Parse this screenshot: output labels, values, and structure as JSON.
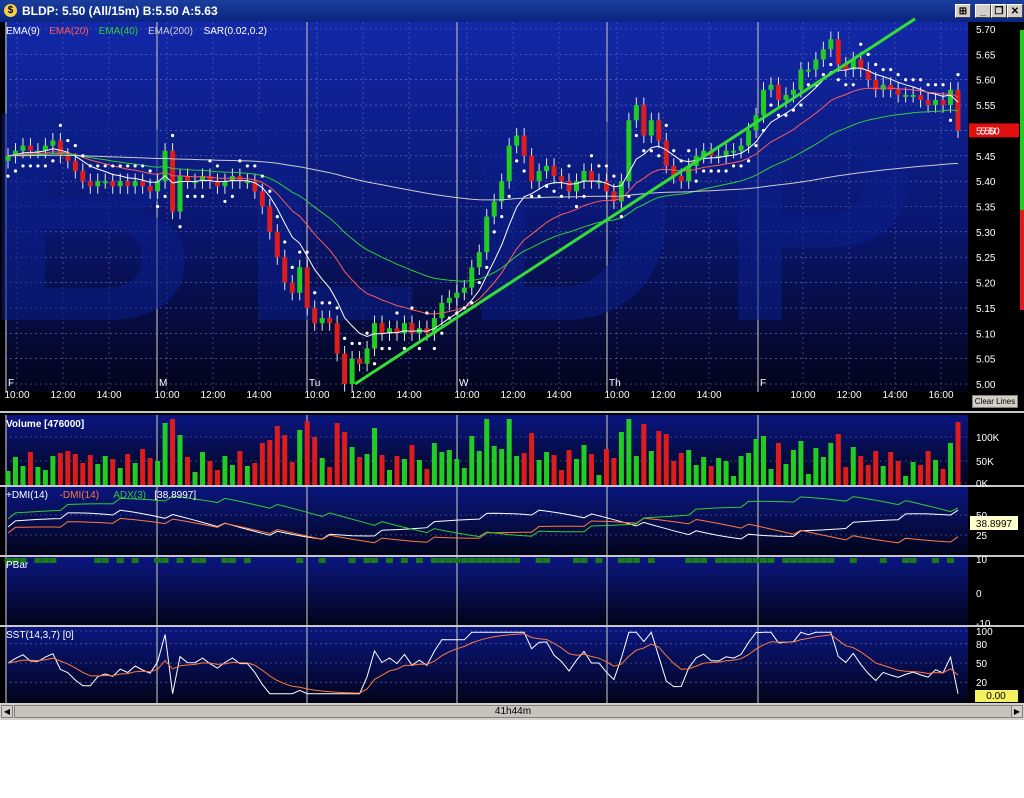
{
  "window": {
    "title": "BLDP: 5.50 (All/15m)  B:5.50  A:5.63",
    "watermark": "BLDP",
    "buttons": [
      "minimize",
      "restore",
      "maximize",
      "close"
    ]
  },
  "colors": {
    "background_top": "#1428a0",
    "background_bottom": "#000010",
    "trendline": "#33dd33",
    "up_candle": "#22cc22",
    "down_candle": "#dd1d1d",
    "sar_dots": "#ffffff",
    "last_price_badge": "#e01010",
    "last_value_badge": "#f5f060"
  },
  "price_panel": {
    "legend": [
      {
        "label": "EMA(9)",
        "color": "#ffffff"
      },
      {
        "label": "EMA(20)",
        "color": "#ff5a5a"
      },
      {
        "label": "EMA(40)",
        "color": "#33cc33"
      },
      {
        "label": "EMA(200)",
        "color": "#cccccc"
      },
      {
        "label": "SAR(0.02,0.2)",
        "color": "#ffffff"
      }
    ],
    "y_ticks": [
      "5.70",
      "5.65",
      "5.60",
      "5.55",
      "5.50",
      "5.45",
      "5.40",
      "5.35",
      "5.30",
      "5.25",
      "5.20",
      "5.15",
      "5.10",
      "5.05",
      "5.00"
    ],
    "last_price": "5.50",
    "day_labels": [
      "F",
      "M",
      "Tu",
      "W",
      "Th",
      "F"
    ],
    "time_labels": [
      "10:00",
      "12:00",
      "14:00",
      "10:00",
      "12:00",
      "14:00",
      "10:00",
      "12:00",
      "14:00",
      "10:00",
      "12:00",
      "14:00",
      "10:00",
      "12:00",
      "14:00",
      "10:00",
      "12:00",
      "14:00",
      "16:00"
    ],
    "clear_lines": "Clear Lines"
  },
  "volume_panel": {
    "title": "Volume",
    "value": "[476000]",
    "y_ticks": [
      "100K",
      "50K",
      "0K"
    ]
  },
  "dmi_panel": {
    "legend": [
      {
        "label": "+DMI(14)",
        "color": "#ffffff"
      },
      {
        "label": "-DMI(14)",
        "color": "#ff7a3a"
      },
      {
        "label": "ADX(3)",
        "color": "#33cc33"
      }
    ],
    "value": "[38.8997]",
    "badge": "38.8997",
    "y_ticks": [
      "50",
      "25"
    ]
  },
  "pbar_panel": {
    "title": "PBar",
    "y_ticks": [
      "10",
      "0",
      "-10"
    ]
  },
  "sst_panel": {
    "title": "SST(14,3,7)",
    "value": "[0]",
    "y_ticks": [
      "100",
      "80",
      "50",
      "20"
    ],
    "badge": "0.00"
  },
  "footer": {
    "scroll_label": "41h44m"
  },
  "chart_data": {
    "type": "candlestick",
    "title": "BLDP: 5.50 (All/15m)",
    "ylim": [
      5.0,
      5.7
    ],
    "series": [
      {
        "name": "Close",
        "values": [
          5.45,
          5.46,
          5.47,
          5.46,
          5.46,
          5.47,
          5.48,
          5.45,
          5.44,
          5.42,
          5.4,
          5.39,
          5.4,
          5.4,
          5.39,
          5.4,
          5.39,
          5.4,
          5.39,
          5.38,
          5.4,
          5.46,
          5.34,
          5.41,
          5.4,
          5.4,
          5.41,
          5.4,
          5.39,
          5.4,
          5.41,
          5.4,
          5.4,
          5.38,
          5.35,
          5.3,
          5.25,
          5.2,
          5.18,
          5.23,
          5.15,
          5.12,
          5.13,
          5.12,
          5.06,
          5.0,
          5.05,
          5.04,
          5.07,
          5.12,
          5.1,
          5.11,
          5.1,
          5.12,
          5.1,
          5.11,
          5.1,
          5.13,
          5.16,
          5.17,
          5.18,
          5.19,
          5.23,
          5.26,
          5.33,
          5.36,
          5.4,
          5.47,
          5.49,
          5.45,
          5.4,
          5.42,
          5.43,
          5.41,
          5.4,
          5.38,
          5.4,
          5.42,
          5.4,
          5.4,
          5.38,
          5.36,
          5.4,
          5.52,
          5.55,
          5.49,
          5.52,
          5.48,
          5.43,
          5.41,
          5.4,
          5.43,
          5.45,
          5.46,
          5.45,
          5.45,
          5.46,
          5.46,
          5.47,
          5.5,
          5.53,
          5.58,
          5.59,
          5.56,
          5.57,
          5.58,
          5.62,
          5.62,
          5.64,
          5.66,
          5.68,
          5.63,
          5.62,
          5.64,
          5.62,
          5.6,
          5.58,
          5.59,
          5.58,
          5.57,
          5.57,
          5.57,
          5.56,
          5.55,
          5.56,
          5.55,
          5.58,
          5.5
        ]
      }
    ]
  }
}
